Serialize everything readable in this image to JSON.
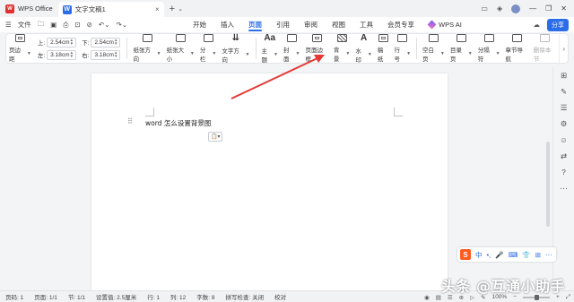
{
  "titlebar": {
    "app_name": "WPS Office",
    "app_logo": "W",
    "doc_tab": "文字文稿1",
    "doc_logo": "W",
    "close_glyph": "×",
    "add_glyph": "+",
    "add_drop_glyph": "⌄"
  },
  "menubar": {
    "file_label": "文件",
    "tabs": [
      "开始",
      "插入",
      "页面",
      "引用",
      "审阅",
      "视图",
      "工具",
      "会员专享"
    ],
    "active_tab": "页面",
    "wps_ai": "WPS AI",
    "share": "分享"
  },
  "ribbon": {
    "margins_label": "页边距",
    "top_label": "上:",
    "top_value": "2.54",
    "bottom_label": "下:",
    "bottom_value": "2.54",
    "left_label": "左:",
    "left_value": "3.18",
    "right_label": "右:",
    "right_value": "3.18",
    "unit": "cm",
    "items": [
      "纸张方向",
      "纸张大小",
      "分栏",
      "文字方向",
      "主题",
      "封面",
      "页面边框",
      "背景",
      "水印",
      "稿纸",
      "行号",
      "空白页",
      "目录页",
      "分隔符",
      "章节导航",
      "删除本节"
    ]
  },
  "document": {
    "text": "word 怎么设置背景图",
    "paste_glyph": "📋▾",
    "drag_glyph": "⠿"
  },
  "ime": {
    "logo": "S",
    "items": [
      "中",
      "•,",
      "🎤",
      "⌨",
      "👕",
      "⊞",
      "⋯"
    ]
  },
  "statusbar": {
    "page": "页码: 1",
    "pages": "页面: 1/1",
    "section": "节: 1/1",
    "setting": "设置值: 2.5厘米",
    "row": "行: 1",
    "col": "列: 12",
    "words": "字数: 8",
    "spell": "拼写检查: 关闭",
    "proof": "校对",
    "zoom": "100%",
    "zoom_level": 0.5
  },
  "watermark": "头条 @互通小助手",
  "colors": {
    "accent": "#2b6de8",
    "arrow": "#e53935",
    "wps_red": "#e0312f"
  }
}
